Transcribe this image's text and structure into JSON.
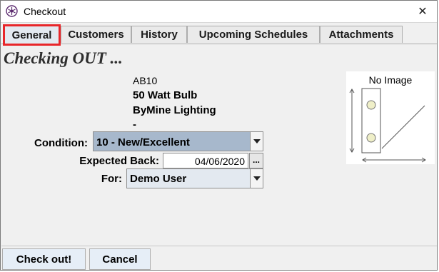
{
  "window": {
    "title": "Checkout",
    "close_glyph": "✕"
  },
  "tabs": [
    {
      "label": "General",
      "active": true
    },
    {
      "label": "Customers",
      "active": false
    },
    {
      "label": "History",
      "active": false
    },
    {
      "label": "Upcoming Schedules",
      "active": false
    },
    {
      "label": "Attachments",
      "active": false
    }
  ],
  "heading": "Checking OUT ...",
  "item": {
    "code": "AB10",
    "name": "50 Watt Bulb",
    "manufacturer": "ByMine Lighting",
    "extra": "-"
  },
  "form": {
    "condition_label": "Condition:",
    "condition_value": "10 - New/Excellent",
    "expected_back_label": "Expected Back:",
    "expected_back_value": "04/06/2020",
    "date_picker_label": "...",
    "for_label": "For:",
    "for_value": "Demo User"
  },
  "image_preview": {
    "caption": "No Image"
  },
  "buttons": {
    "checkout": "Check out!",
    "cancel": "Cancel"
  },
  "colors": {
    "highlight_border": "#e8262a",
    "condition_bg": "#a7b8cc",
    "for_bg": "#e3e9f0"
  }
}
